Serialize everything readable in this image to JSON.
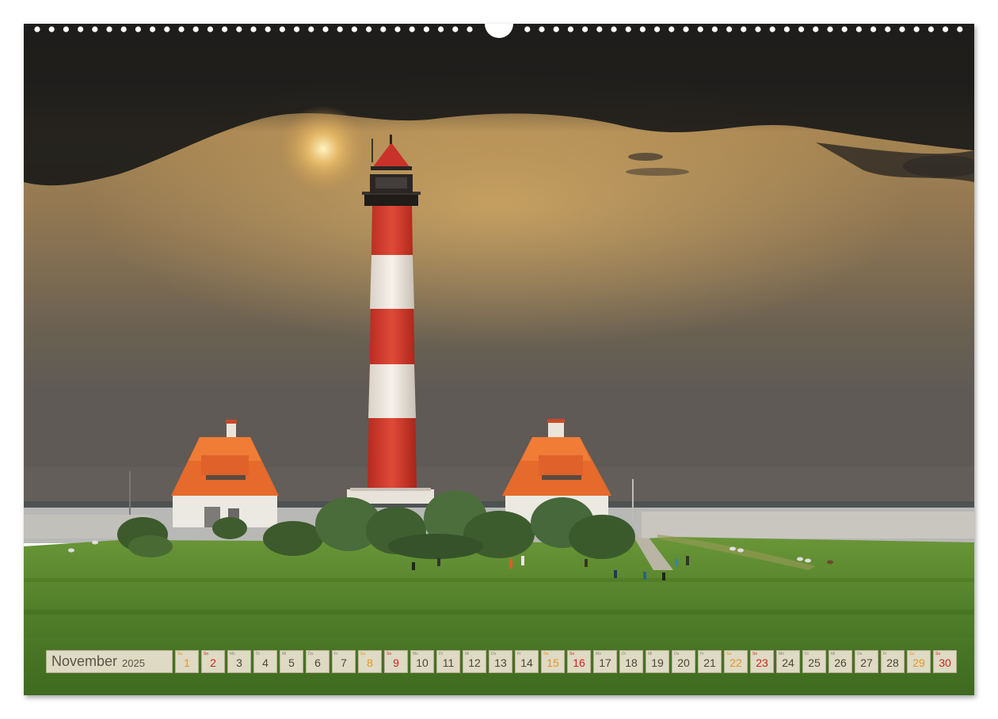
{
  "calendar": {
    "month": "November",
    "year": "2025",
    "days": [
      {
        "wd": "Sa",
        "d": "1",
        "t": "sat"
      },
      {
        "wd": "So",
        "d": "2",
        "t": "sun"
      },
      {
        "wd": "Mo",
        "d": "3",
        "t": ""
      },
      {
        "wd": "Di",
        "d": "4",
        "t": ""
      },
      {
        "wd": "Mi",
        "d": "5",
        "t": ""
      },
      {
        "wd": "Do",
        "d": "6",
        "t": ""
      },
      {
        "wd": "Fr",
        "d": "7",
        "t": ""
      },
      {
        "wd": "Sa",
        "d": "8",
        "t": "sat"
      },
      {
        "wd": "So",
        "d": "9",
        "t": "sun"
      },
      {
        "wd": "Mo",
        "d": "10",
        "t": ""
      },
      {
        "wd": "Di",
        "d": "11",
        "t": ""
      },
      {
        "wd": "Mi",
        "d": "12",
        "t": ""
      },
      {
        "wd": "Do",
        "d": "13",
        "t": ""
      },
      {
        "wd": "Fr",
        "d": "14",
        "t": ""
      },
      {
        "wd": "Sa",
        "d": "15",
        "t": "sat"
      },
      {
        "wd": "So",
        "d": "16",
        "t": "sun"
      },
      {
        "wd": "Mo",
        "d": "17",
        "t": ""
      },
      {
        "wd": "Di",
        "d": "18",
        "t": ""
      },
      {
        "wd": "Mi",
        "d": "19",
        "t": ""
      },
      {
        "wd": "Do",
        "d": "20",
        "t": ""
      },
      {
        "wd": "Fr",
        "d": "21",
        "t": ""
      },
      {
        "wd": "Sa",
        "d": "22",
        "t": "sat"
      },
      {
        "wd": "So",
        "d": "23",
        "t": "sun"
      },
      {
        "wd": "Mo",
        "d": "24",
        "t": ""
      },
      {
        "wd": "Di",
        "d": "25",
        "t": ""
      },
      {
        "wd": "Mi",
        "d": "26",
        "t": ""
      },
      {
        "wd": "Do",
        "d": "27",
        "t": ""
      },
      {
        "wd": "Fr",
        "d": "28",
        "t": ""
      },
      {
        "wd": "Sa",
        "d": "29",
        "t": "sat"
      },
      {
        "wd": "So",
        "d": "30",
        "t": "sun"
      }
    ]
  },
  "colors": {
    "saturday": "#e5962b",
    "sunday": "#d0241c",
    "tower_red": "#d8382c",
    "roof_orange": "#e8682a",
    "meadow": "#5c8a2e"
  },
  "icons": [
    "spiral-binding-icon",
    "lighthouse-photo"
  ]
}
